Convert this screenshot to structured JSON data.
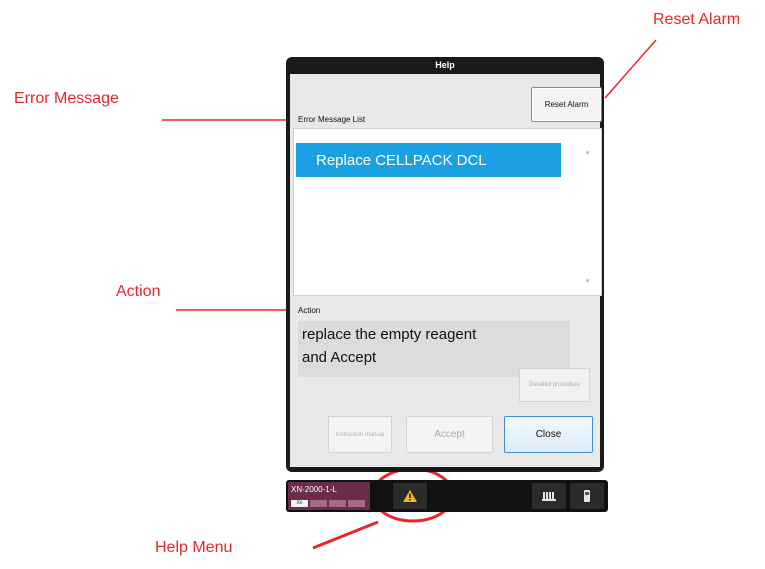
{
  "annotations": {
    "reset_alarm": "Reset Alarm",
    "error_message": "Error Message",
    "action": "Action",
    "help_menu": "Help Menu",
    "color": "#e8252b"
  },
  "dialog": {
    "title": "Help",
    "error_list_label": "Error Message List",
    "reset_alarm_button": "Reset Alarm",
    "selected_error": "Replace CELLPACK DCL",
    "action_label": "Action",
    "action_text_line1": "replace the empty reagent",
    "action_text_line2": "and Accept",
    "detailed_procedure_button": "Detailed procedure",
    "instruction_manual_button": "Instruction manual",
    "accept_button": "Accept",
    "close_button": "Close",
    "colors": {
      "selection": "#1aa0e3",
      "close_border": "#3c8fd6"
    }
  },
  "taskbar": {
    "model": "XN-2000-1-L",
    "chips": [
      "Xn",
      "",
      "",
      ""
    ],
    "warning_icon": "warning-triangle-icon",
    "rack_icon": "rack-icon",
    "tube_icon": "tube-icon"
  }
}
